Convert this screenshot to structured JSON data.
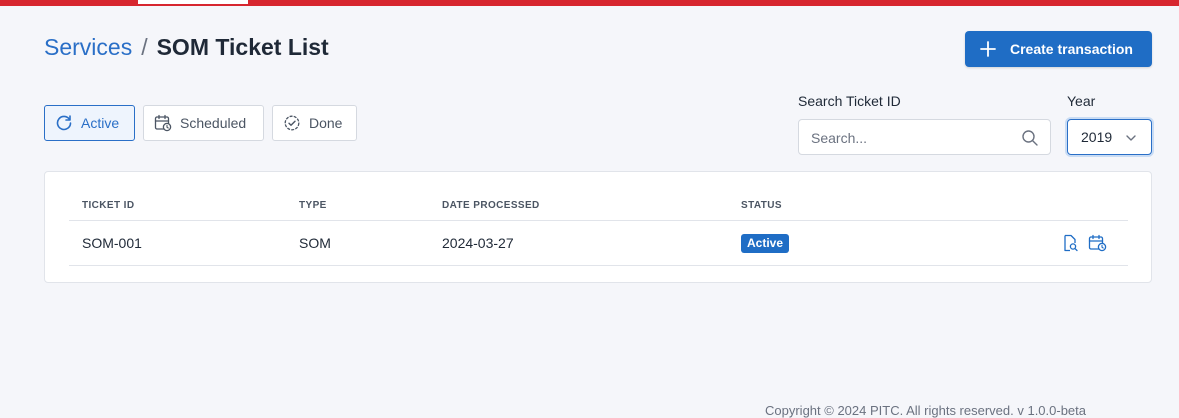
{
  "breadcrumb": {
    "parent": "Services",
    "separator": "/",
    "current": "SOM Ticket List"
  },
  "actions": {
    "create_label": "Create transaction"
  },
  "tabs": [
    {
      "label": "Active",
      "icon": "refresh-icon",
      "selected": true
    },
    {
      "label": "Scheduled",
      "icon": "calendar-clock-icon",
      "selected": false
    },
    {
      "label": "Done",
      "icon": "check-circle-icon",
      "selected": false
    }
  ],
  "search": {
    "label": "Search Ticket ID",
    "placeholder": "Search...",
    "value": ""
  },
  "year": {
    "label": "Year",
    "value": "2019"
  },
  "table": {
    "headers": [
      "TICKET ID",
      "TYPE",
      "DATE PROCESSED",
      "STATUS"
    ],
    "rows": [
      {
        "ticket_id": "SOM-001",
        "type": "SOM",
        "date_processed": "2024-03-27",
        "status": "Active"
      }
    ]
  },
  "footer": {
    "text": "Copyright © 2024 PITC. All rights reserved. v 1.0.0-beta"
  },
  "colors": {
    "accent": "#1f6dc5",
    "brand_bar": "#d7262f"
  }
}
